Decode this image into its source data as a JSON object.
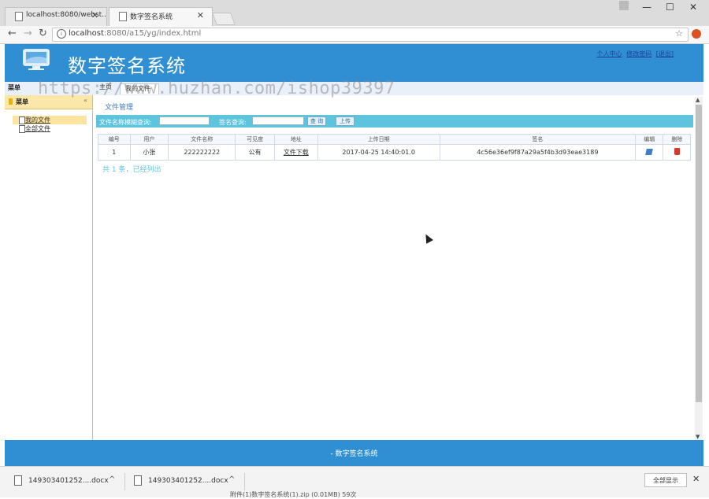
{
  "browser": {
    "tabs": [
      {
        "title": "localhost:8080/webst..."
      },
      {
        "title": "数字签名系统"
      }
    ],
    "url_host": "localhost",
    "url_path": ":8080/a15/yg/index.html",
    "window_controls": {
      "minimize": "—",
      "maximize": "☐",
      "close": "✕"
    }
  },
  "header": {
    "title": "数字签名系统",
    "links": [
      "个人中心",
      "修改密码",
      "[退出]"
    ]
  },
  "watermark": "https://www.huzhan.com/ishop39397",
  "tabstrip": {
    "menu_label": "菜单",
    "home_tab": "主页",
    "active_tab": "我的文件"
  },
  "sidebar": {
    "title": "菜单",
    "collapse": "«",
    "items": [
      {
        "label": "我的文件"
      },
      {
        "label": "全部文件"
      }
    ]
  },
  "main": {
    "panel_title": "文件管理",
    "search": {
      "filename_label": "文件名称模糊查询:",
      "signature_label": "签名查询:",
      "query_button": "查 询",
      "upload_button": "上传"
    },
    "table": {
      "columns": [
        "编号",
        "用户",
        "文件名称",
        "可见度",
        "地址",
        "上传日期",
        "签名",
        "编辑",
        "删除"
      ],
      "rows": [
        {
          "id": "1",
          "user": "小张",
          "filename": "222222222",
          "visibility": "公有",
          "link": "文件下载",
          "date": "2017-04-25 14:40:01.0",
          "signature": "4c56e36ef9f87a29a5f4b3d93eae3189"
        }
      ]
    },
    "summary": "共 1 条，已经列出"
  },
  "footer": {
    "text": "- 数字签名系统"
  },
  "downloads": {
    "items": [
      {
        "name": "149303401252....docx"
      },
      {
        "name": "149303401252....docx"
      }
    ],
    "show_all": "全部显示",
    "caption": "附件(1)数字签名系统(1).zip (0.01MB) 59次"
  },
  "colors": {
    "header_blue": "#2f8fd2",
    "search_bar": "#5ec3dd",
    "sidebar_highlight": "#fbe3a0",
    "delete_red": "#d0392c"
  }
}
